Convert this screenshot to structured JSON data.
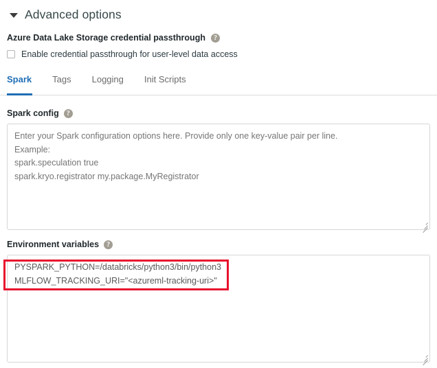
{
  "section": {
    "title": "Advanced options",
    "caret_icon": "caret-down-icon",
    "expanded": true
  },
  "passthrough": {
    "label": "Azure Data Lake Storage credential passthrough",
    "help_icon": "help-circle-icon",
    "help_glyph": "?",
    "checkbox_label": "Enable credential passthrough for user-level data access",
    "checked": false
  },
  "tabs": [
    {
      "label": "Spark",
      "active": true
    },
    {
      "label": "Tags",
      "active": false
    },
    {
      "label": "Logging",
      "active": false
    },
    {
      "label": "Init Scripts",
      "active": false
    }
  ],
  "spark_config": {
    "label": "Spark config",
    "help_icon": "help-circle-icon",
    "help_glyph": "?",
    "value": "",
    "placeholder": "Enter your Spark configuration options here. Provide only one key-value pair per line.\nExample:\nspark.speculation true\nspark.kryo.registrator my.package.MyRegistrator"
  },
  "environment_variables": {
    "label": "Environment variables",
    "help_icon": "help-circle-icon",
    "help_glyph": "?",
    "value": "PYSPARK_PYTHON=/databricks/python3/bin/python3\nMLFLOW_TRACKING_URI=\"<azureml-tracking-uri>\"",
    "placeholder": ""
  },
  "annotation": {
    "name": "red-highlight-box",
    "color": "#e8112d"
  },
  "colors": {
    "accent": "#1f6eb5",
    "text": "#1f272b",
    "muted": "#6d6d6d",
    "border": "#d6d6d6",
    "highlight": "#e8112d"
  }
}
